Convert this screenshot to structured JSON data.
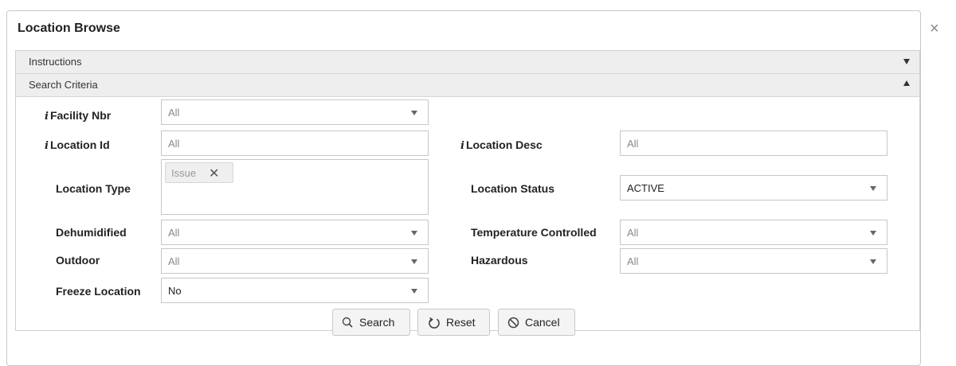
{
  "dialog": {
    "title": "Location Browse",
    "close_glyph": "×"
  },
  "sections": {
    "instructions": "Instructions",
    "search_criteria": "Search Criteria"
  },
  "info_glyph": "i",
  "fields": {
    "facility_nbr": {
      "label": "Facility Nbr",
      "value": "All"
    },
    "location_id": {
      "label": "Location Id",
      "value": "All"
    },
    "location_desc": {
      "label": "Location Desc",
      "value": "All"
    },
    "location_type": {
      "label": "Location Type",
      "chips": [
        "Issue"
      ]
    },
    "location_status": {
      "label": "Location Status",
      "value": "ACTIVE"
    },
    "dehumidified": {
      "label": "Dehumidified",
      "value": "All"
    },
    "temperature_controlled": {
      "label": "Temperature Controlled",
      "value": "All"
    },
    "outdoor": {
      "label": "Outdoor",
      "value": "All"
    },
    "hazardous": {
      "label": "Hazardous",
      "value": "All"
    },
    "freeze_location": {
      "label": "Freeze Location",
      "value": "No"
    }
  },
  "buttons": {
    "search": "Search",
    "reset": "Reset",
    "cancel": "Cancel"
  },
  "chip_remove_glyph": "✕"
}
